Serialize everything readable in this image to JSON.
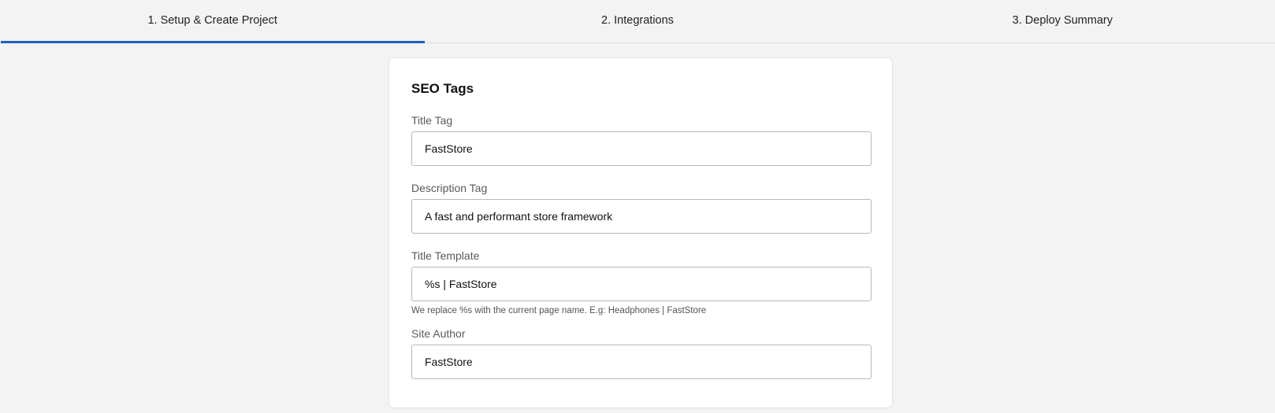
{
  "stepper": {
    "steps": [
      {
        "label": "1. Setup & Create Project",
        "active": true
      },
      {
        "label": "2. Integrations",
        "active": false
      },
      {
        "label": "3. Deploy Summary",
        "active": false
      }
    ],
    "accent_color": "#1f5fbf"
  },
  "seo": {
    "title": "SEO Tags",
    "fields": [
      {
        "label": "Title Tag",
        "value": "FastStore"
      },
      {
        "label": "Description Tag",
        "value": "A fast and performant store framework"
      },
      {
        "label": "Title Template",
        "value": "%s | FastStore",
        "helper": "We replace %s with the current page name. E.g: Headphones | FastStore"
      },
      {
        "label": "Site Author",
        "value": "FastStore"
      }
    ]
  }
}
